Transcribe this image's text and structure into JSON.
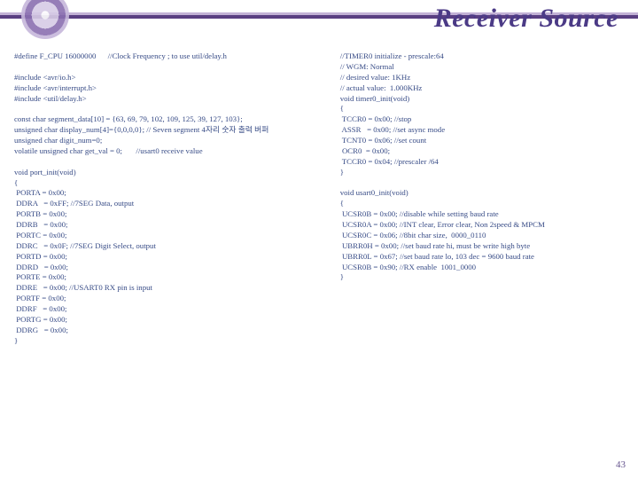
{
  "title": "Receiver Source",
  "page_number": "43",
  "code": {
    "left": "#define F_CPU 16000000      //Clock Frequency ; to use util/delay.h\n\n#include <avr/io.h>\n#include <avr/interrupt.h>\n#include <util/delay.h>\n\nconst char segment_data[10] = {63, 69, 79, 102, 109, 125, 39, 127, 103};\nunsigned char display_num[4]={0,0,0,0}; // Seven segment 4자리 숫자 출력 버퍼\nunsigned char digit_num=0;\nvolatile unsigned char get_val = 0;       //usart0 receive value\n\nvoid port_init(void)\n{\n PORTA = 0x00;\n DDRA   = 0xFF; //7SEG Data, output\n PORTB = 0x00;\n DDRB   = 0x00;\n PORTC = 0x00;\n DDRC   = 0x0F; //7SEG Digit Select, output\n PORTD = 0x00;\n DDRD   = 0x00;\n PORTE = 0x00;\n DDRE   = 0x00; //USART0 RX pin is input\n PORTF = 0x00;\n DDRF   = 0x00;\n PORTG = 0x00;\n DDRG   = 0x00;\n}",
    "right": "//TIMER0 initialize - prescale:64\n// WGM: Normal\n// desired value: 1KHz\n// actual value:  1.000KHz\nvoid timer0_init(void)\n{\n TCCR0 = 0x00; //stop\n ASSR   = 0x00; //set async mode\n TCNT0 = 0x06; //set count\n OCR0  = 0x00;\n TCCR0 = 0x04; //prescaler /64\n}\n\nvoid usart0_init(void)\n{\n UCSR0B = 0x00; //disable while setting baud rate\n UCSR0A = 0x00; //INT clear, Error clear, Non 2speed & MPCM\n UCSR0C = 0x06; //8bit char size,  0000_0110\n UBRR0H = 0x00; //set baud rate hi, must be write high byte\n UBRR0L = 0x67; //set baud rate lo, 103 dec = 9600 baud rate\n UCSR0B = 0x90; //RX enable  1001_0000\n}"
  }
}
